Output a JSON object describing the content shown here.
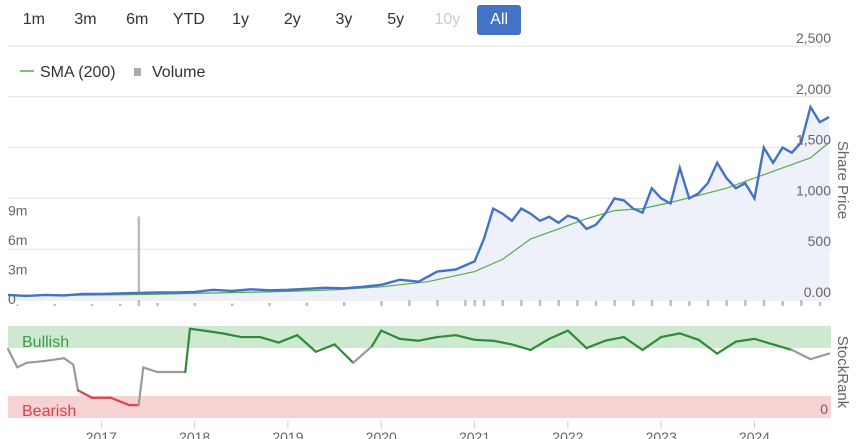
{
  "range_selector": {
    "buttons": [
      {
        "label": "1m",
        "state": "normal"
      },
      {
        "label": "3m",
        "state": "normal"
      },
      {
        "label": "6m",
        "state": "normal"
      },
      {
        "label": "YTD",
        "state": "normal"
      },
      {
        "label": "1y",
        "state": "normal"
      },
      {
        "label": "2y",
        "state": "normal"
      },
      {
        "label": "3y",
        "state": "normal"
      },
      {
        "label": "5y",
        "state": "normal"
      },
      {
        "label": "10y",
        "state": "disabled"
      },
      {
        "label": "All",
        "state": "active"
      }
    ]
  },
  "chart_data": [
    {
      "type": "line",
      "name_price": "",
      "ylabel": "Share Price",
      "ylim": [
        0,
        2500
      ],
      "yticks": [
        "0.00",
        "500",
        "1,000",
        "1,500",
        "2,000",
        "2,500"
      ],
      "volume_ticks": [
        "0",
        "3m",
        "6m",
        "9m"
      ],
      "legend": [
        {
          "label": "SMA (200)",
          "color": "#5aa84f",
          "kind": "line"
        },
        {
          "label": "Volume",
          "color": "#aaaaaa",
          "kind": "square"
        }
      ],
      "price_color": "#4472c4",
      "sma_color": "#5aa84f",
      "volume_color": "#bbbbbb",
      "price_series": {
        "x": [
          2016.0,
          2016.2,
          2016.4,
          2016.6,
          2016.8,
          2017.0,
          2017.2,
          2017.4,
          2017.6,
          2017.8,
          2018.0,
          2018.2,
          2018.4,
          2018.6,
          2018.8,
          2019.0,
          2019.2,
          2019.4,
          2019.6,
          2019.8,
          2020.0,
          2020.2,
          2020.4,
          2020.6,
          2020.8,
          2021.0,
          2021.1,
          2021.2,
          2021.3,
          2021.4,
          2021.5,
          2021.6,
          2021.7,
          2021.8,
          2021.9,
          2022.0,
          2022.1,
          2022.2,
          2022.3,
          2022.4,
          2022.5,
          2022.6,
          2022.7,
          2022.8,
          2022.9,
          2023.0,
          2023.1,
          2023.2,
          2023.3,
          2023.4,
          2023.5,
          2023.6,
          2023.7,
          2023.8,
          2023.9,
          2024.0,
          2024.1,
          2024.2,
          2024.3,
          2024.4,
          2024.5,
          2024.6,
          2024.7,
          2024.8
        ],
        "y": [
          50,
          40,
          50,
          45,
          60,
          60,
          65,
          70,
          75,
          75,
          80,
          100,
          90,
          105,
          95,
          100,
          110,
          120,
          115,
          130,
          150,
          200,
          180,
          280,
          300,
          380,
          600,
          900,
          850,
          780,
          900,
          850,
          780,
          820,
          760,
          830,
          800,
          700,
          740,
          850,
          1000,
          980,
          900,
          860,
          1100,
          1000,
          950,
          1300,
          1000,
          1050,
          1150,
          1350,
          1200,
          1100,
          1150,
          1000,
          1500,
          1350,
          1500,
          1450,
          1550,
          1900,
          1750,
          1800
        ]
      },
      "sma_series": {
        "x": [
          2016.0,
          2016.5,
          2017.0,
          2017.5,
          2018.0,
          2018.5,
          2019.0,
          2019.5,
          2020.0,
          2020.5,
          2021.0,
          2021.3,
          2021.6,
          2021.9,
          2022.2,
          2022.5,
          2022.8,
          2023.1,
          2023.4,
          2023.7,
          2024.0,
          2024.3,
          2024.6,
          2024.8
        ],
        "y": [
          45,
          45,
          50,
          55,
          65,
          75,
          85,
          100,
          130,
          180,
          280,
          400,
          600,
          700,
          800,
          880,
          900,
          960,
          1030,
          1100,
          1200,
          1300,
          1400,
          1550
        ]
      },
      "volume_series": {
        "x": [
          2016.1,
          2016.5,
          2016.9,
          2017.2,
          2017.4,
          2017.6,
          2018.0,
          2018.4,
          2018.8,
          2019.2,
          2019.6,
          2020.0,
          2020.3,
          2020.6,
          2020.9,
          2021.0,
          2021.1,
          2021.3,
          2021.5,
          2021.7,
          2021.9,
          2022.1,
          2022.3,
          2022.5,
          2022.7,
          2022.9,
          2023.1,
          2023.3,
          2023.5,
          2023.7,
          2023.9,
          2024.1,
          2024.3,
          2024.5,
          2024.7
        ],
        "y": [
          0.15,
          0.2,
          0.2,
          0.2,
          9.1,
          0.3,
          0.3,
          0.25,
          0.3,
          0.35,
          0.4,
          0.5,
          0.6,
          1.0,
          1.2,
          2.5,
          1.5,
          0.8,
          0.7,
          0.6,
          0.9,
          0.6,
          0.5,
          0.7,
          1.7,
          0.6,
          0.9,
          0.5,
          0.8,
          0.6,
          0.7,
          0.9,
          0.5,
          0.6,
          0.4
        ]
      },
      "volume_ylim": [
        0,
        12
      ]
    },
    {
      "type": "line",
      "ylabel": "StockRank",
      "ylim": [
        0,
        100
      ],
      "yticks": [
        "0"
      ],
      "bands": [
        {
          "label": "Bullish",
          "from": 70,
          "to": 100,
          "color": "#cfe8d0"
        },
        {
          "label": "Bearish",
          "from": 0,
          "to": 30,
          "color": "#f6d2d3"
        }
      ],
      "x": [
        2016.0,
        2016.1,
        2016.2,
        2016.4,
        2016.6,
        2016.7,
        2016.75,
        2016.9,
        2017.1,
        2017.3,
        2017.4,
        2017.45,
        2017.6,
        2017.8,
        2017.9,
        2017.95,
        2018.1,
        2018.3,
        2018.5,
        2018.7,
        2018.9,
        2019.1,
        2019.3,
        2019.5,
        2019.7,
        2019.9,
        2020.0,
        2020.2,
        2020.4,
        2020.6,
        2020.8,
        2021.0,
        2021.2,
        2021.4,
        2021.6,
        2021.8,
        2022.0,
        2022.2,
        2022.4,
        2022.6,
        2022.8,
        2023.0,
        2023.2,
        2023.4,
        2023.6,
        2023.8,
        2024.0,
        2024.2,
        2024.4,
        2024.6,
        2024.8
      ],
      "y": [
        75,
        55,
        60,
        62,
        65,
        58,
        30,
        22,
        22,
        14,
        14,
        55,
        50,
        50,
        50,
        97,
        95,
        92,
        88,
        88,
        82,
        90,
        72,
        80,
        60,
        78,
        95,
        86,
        84,
        88,
        90,
        85,
        84,
        80,
        74,
        86,
        95,
        76,
        84,
        88,
        74,
        88,
        92,
        85,
        70,
        83,
        86,
        80,
        74,
        64,
        70
      ]
    }
  ],
  "x_axis": {
    "ticks": [
      "2017",
      "2018",
      "2019",
      "2020",
      "2021",
      "2022",
      "2023",
      "2024"
    ],
    "tick_values": [
      2017,
      2018,
      2019,
      2020,
      2021,
      2022,
      2023,
      2024
    ],
    "xlim": [
      2016.0,
      2024.82
    ]
  }
}
